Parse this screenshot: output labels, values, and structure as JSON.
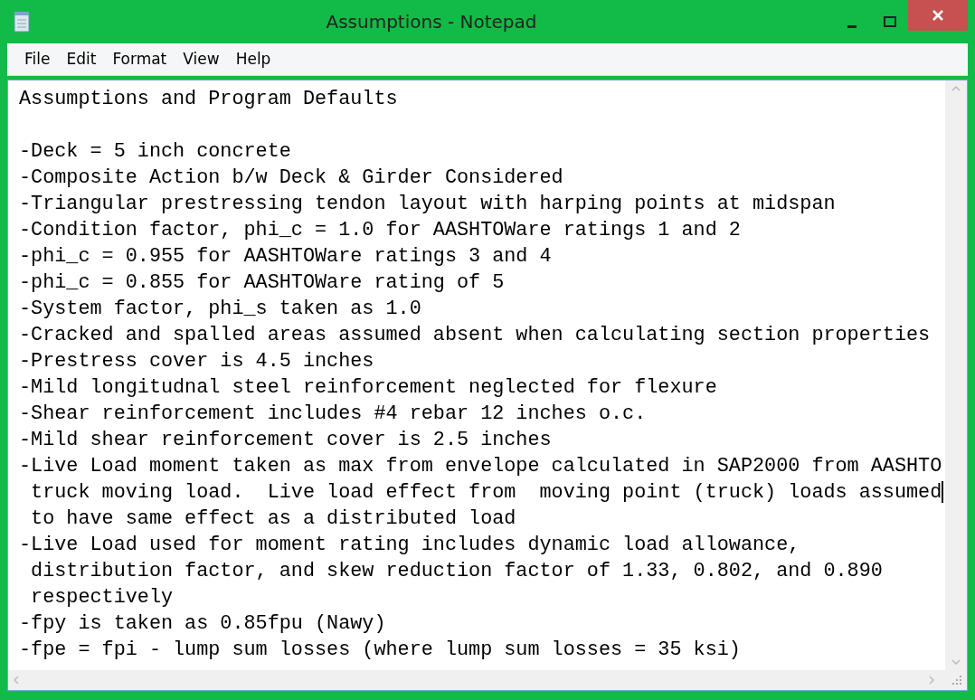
{
  "window": {
    "title": "Assumptions - Notepad"
  },
  "menu": [
    "File",
    "Edit",
    "Format",
    "View",
    "Help"
  ],
  "document": {
    "heading": "Assumptions and Program Defaults",
    "lines": [
      {
        "text": "-Deck = 5 inch concrete",
        "cursor": false
      },
      {
        "text": "-Composite Action b/w Deck & Girder Considered",
        "cursor": false
      },
      {
        "text": "-Triangular prestressing tendon layout with harping points at midspan",
        "cursor": false
      },
      {
        "text": "-Condition factor, phi_c = 1.0 for AASHTOWare ratings 1 and 2",
        "cursor": false
      },
      {
        "text": "-phi_c = 0.955 for AASHTOWare ratings 3 and 4",
        "cursor": false
      },
      {
        "text": "-phi_c = 0.855 for AASHTOWare rating of 5",
        "cursor": false
      },
      {
        "text": "-System factor, phi_s taken as 1.0",
        "cursor": false
      },
      {
        "text": "-Cracked and spalled areas assumed absent when calculating section properties",
        "cursor": false
      },
      {
        "text": "-Prestress cover is 4.5 inches",
        "cursor": false
      },
      {
        "text": "-Mild longitudnal steel reinforcement neglected for flexure",
        "cursor": false
      },
      {
        "text": "-Shear reinforcement includes #4 rebar 12 inches o.c.",
        "cursor": false
      },
      {
        "text": "-Mild shear reinforcement cover is 2.5 inches",
        "cursor": false
      },
      {
        "text": "-Live Load moment taken as max from envelope calculated in SAP2000 from AASHTO",
        "cursor": false
      },
      {
        "text": " truck moving load.  Live load effect from  moving point (truck) loads assumed",
        "cursor": true
      },
      {
        "text": " to have same effect as a distributed load",
        "cursor": false
      },
      {
        "text": "-Live Load used for moment rating includes dynamic load allowance,",
        "cursor": false
      },
      {
        "text": " distribution factor, and skew reduction factor of 1.33, 0.802, and 0.890",
        "cursor": false
      },
      {
        "text": " respectively",
        "cursor": false
      },
      {
        "text": "-fpy is taken as 0.85fpu (Nawy)",
        "cursor": false
      },
      {
        "text": "-fpe = fpi - lump sum losses (where lump sum losses = 35 ksi)",
        "cursor": false
      }
    ]
  }
}
